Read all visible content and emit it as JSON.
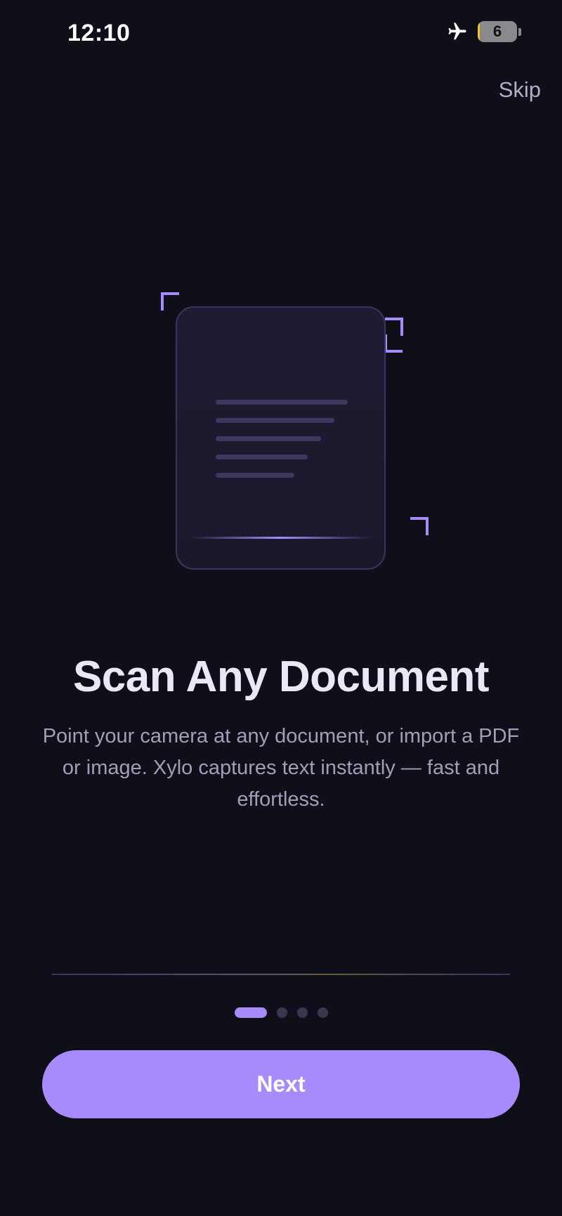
{
  "status_bar": {
    "time": "12:10",
    "airplane_mode_icon": "airplane-icon",
    "battery_level": "6",
    "battery_fill_fraction": 0.06
  },
  "header": {
    "skip_label": "Skip"
  },
  "illustration": {
    "icon": "document-scan-icon",
    "accent_color": "#a78bfa"
  },
  "content": {
    "title": "Scan Any Document",
    "description": "Point your camera at any document, or import a PDF or image. Xylo captures text instantly — fast and effortless."
  },
  "pagination": {
    "total_pages": 4,
    "current_page": 1
  },
  "footer": {
    "next_label": "Next"
  },
  "colors": {
    "background": "#0f0f1a",
    "accent": "#a78bfa",
    "title_text": "#e9e8f5",
    "body_text": "#a29eb8"
  }
}
